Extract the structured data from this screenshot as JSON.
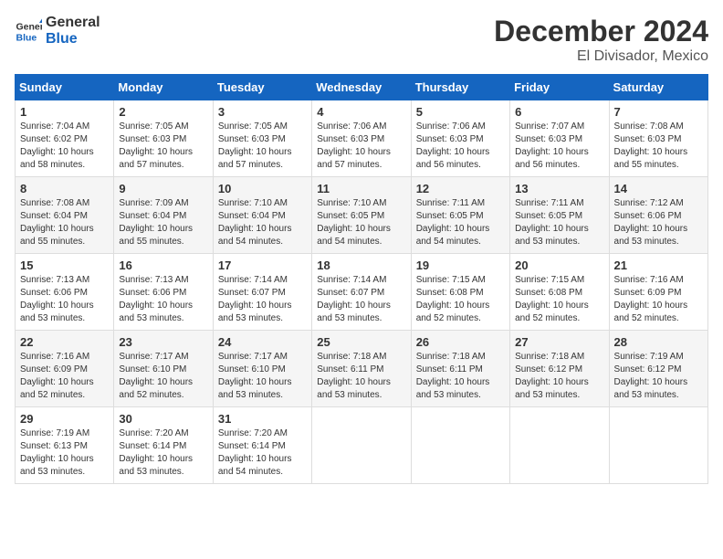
{
  "header": {
    "logo_general": "General",
    "logo_blue": "Blue",
    "month_title": "December 2024",
    "location": "El Divisador, Mexico"
  },
  "days_of_week": [
    "Sunday",
    "Monday",
    "Tuesday",
    "Wednesday",
    "Thursday",
    "Friday",
    "Saturday"
  ],
  "weeks": [
    [
      {
        "day": "1",
        "sunrise": "7:04 AM",
        "sunset": "6:02 PM",
        "daylight": "10 hours and 58 minutes."
      },
      {
        "day": "2",
        "sunrise": "7:05 AM",
        "sunset": "6:03 PM",
        "daylight": "10 hours and 57 minutes."
      },
      {
        "day": "3",
        "sunrise": "7:05 AM",
        "sunset": "6:03 PM",
        "daylight": "10 hours and 57 minutes."
      },
      {
        "day": "4",
        "sunrise": "7:06 AM",
        "sunset": "6:03 PM",
        "daylight": "10 hours and 57 minutes."
      },
      {
        "day": "5",
        "sunrise": "7:06 AM",
        "sunset": "6:03 PM",
        "daylight": "10 hours and 56 minutes."
      },
      {
        "day": "6",
        "sunrise": "7:07 AM",
        "sunset": "6:03 PM",
        "daylight": "10 hours and 56 minutes."
      },
      {
        "day": "7",
        "sunrise": "7:08 AM",
        "sunset": "6:03 PM",
        "daylight": "10 hours and 55 minutes."
      }
    ],
    [
      {
        "day": "8",
        "sunrise": "7:08 AM",
        "sunset": "6:04 PM",
        "daylight": "10 hours and 55 minutes."
      },
      {
        "day": "9",
        "sunrise": "7:09 AM",
        "sunset": "6:04 PM",
        "daylight": "10 hours and 55 minutes."
      },
      {
        "day": "10",
        "sunrise": "7:10 AM",
        "sunset": "6:04 PM",
        "daylight": "10 hours and 54 minutes."
      },
      {
        "day": "11",
        "sunrise": "7:10 AM",
        "sunset": "6:05 PM",
        "daylight": "10 hours and 54 minutes."
      },
      {
        "day": "12",
        "sunrise": "7:11 AM",
        "sunset": "6:05 PM",
        "daylight": "10 hours and 54 minutes."
      },
      {
        "day": "13",
        "sunrise": "7:11 AM",
        "sunset": "6:05 PM",
        "daylight": "10 hours and 53 minutes."
      },
      {
        "day": "14",
        "sunrise": "7:12 AM",
        "sunset": "6:06 PM",
        "daylight": "10 hours and 53 minutes."
      }
    ],
    [
      {
        "day": "15",
        "sunrise": "7:13 AM",
        "sunset": "6:06 PM",
        "daylight": "10 hours and 53 minutes."
      },
      {
        "day": "16",
        "sunrise": "7:13 AM",
        "sunset": "6:06 PM",
        "daylight": "10 hours and 53 minutes."
      },
      {
        "day": "17",
        "sunrise": "7:14 AM",
        "sunset": "6:07 PM",
        "daylight": "10 hours and 53 minutes."
      },
      {
        "day": "18",
        "sunrise": "7:14 AM",
        "sunset": "6:07 PM",
        "daylight": "10 hours and 53 minutes."
      },
      {
        "day": "19",
        "sunrise": "7:15 AM",
        "sunset": "6:08 PM",
        "daylight": "10 hours and 52 minutes."
      },
      {
        "day": "20",
        "sunrise": "7:15 AM",
        "sunset": "6:08 PM",
        "daylight": "10 hours and 52 minutes."
      },
      {
        "day": "21",
        "sunrise": "7:16 AM",
        "sunset": "6:09 PM",
        "daylight": "10 hours and 52 minutes."
      }
    ],
    [
      {
        "day": "22",
        "sunrise": "7:16 AM",
        "sunset": "6:09 PM",
        "daylight": "10 hours and 52 minutes."
      },
      {
        "day": "23",
        "sunrise": "7:17 AM",
        "sunset": "6:10 PM",
        "daylight": "10 hours and 52 minutes."
      },
      {
        "day": "24",
        "sunrise": "7:17 AM",
        "sunset": "6:10 PM",
        "daylight": "10 hours and 53 minutes."
      },
      {
        "day": "25",
        "sunrise": "7:18 AM",
        "sunset": "6:11 PM",
        "daylight": "10 hours and 53 minutes."
      },
      {
        "day": "26",
        "sunrise": "7:18 AM",
        "sunset": "6:11 PM",
        "daylight": "10 hours and 53 minutes."
      },
      {
        "day": "27",
        "sunrise": "7:18 AM",
        "sunset": "6:12 PM",
        "daylight": "10 hours and 53 minutes."
      },
      {
        "day": "28",
        "sunrise": "7:19 AM",
        "sunset": "6:12 PM",
        "daylight": "10 hours and 53 minutes."
      }
    ],
    [
      {
        "day": "29",
        "sunrise": "7:19 AM",
        "sunset": "6:13 PM",
        "daylight": "10 hours and 53 minutes."
      },
      {
        "day": "30",
        "sunrise": "7:20 AM",
        "sunset": "6:14 PM",
        "daylight": "10 hours and 53 minutes."
      },
      {
        "day": "31",
        "sunrise": "7:20 AM",
        "sunset": "6:14 PM",
        "daylight": "10 hours and 54 minutes."
      },
      null,
      null,
      null,
      null
    ]
  ]
}
